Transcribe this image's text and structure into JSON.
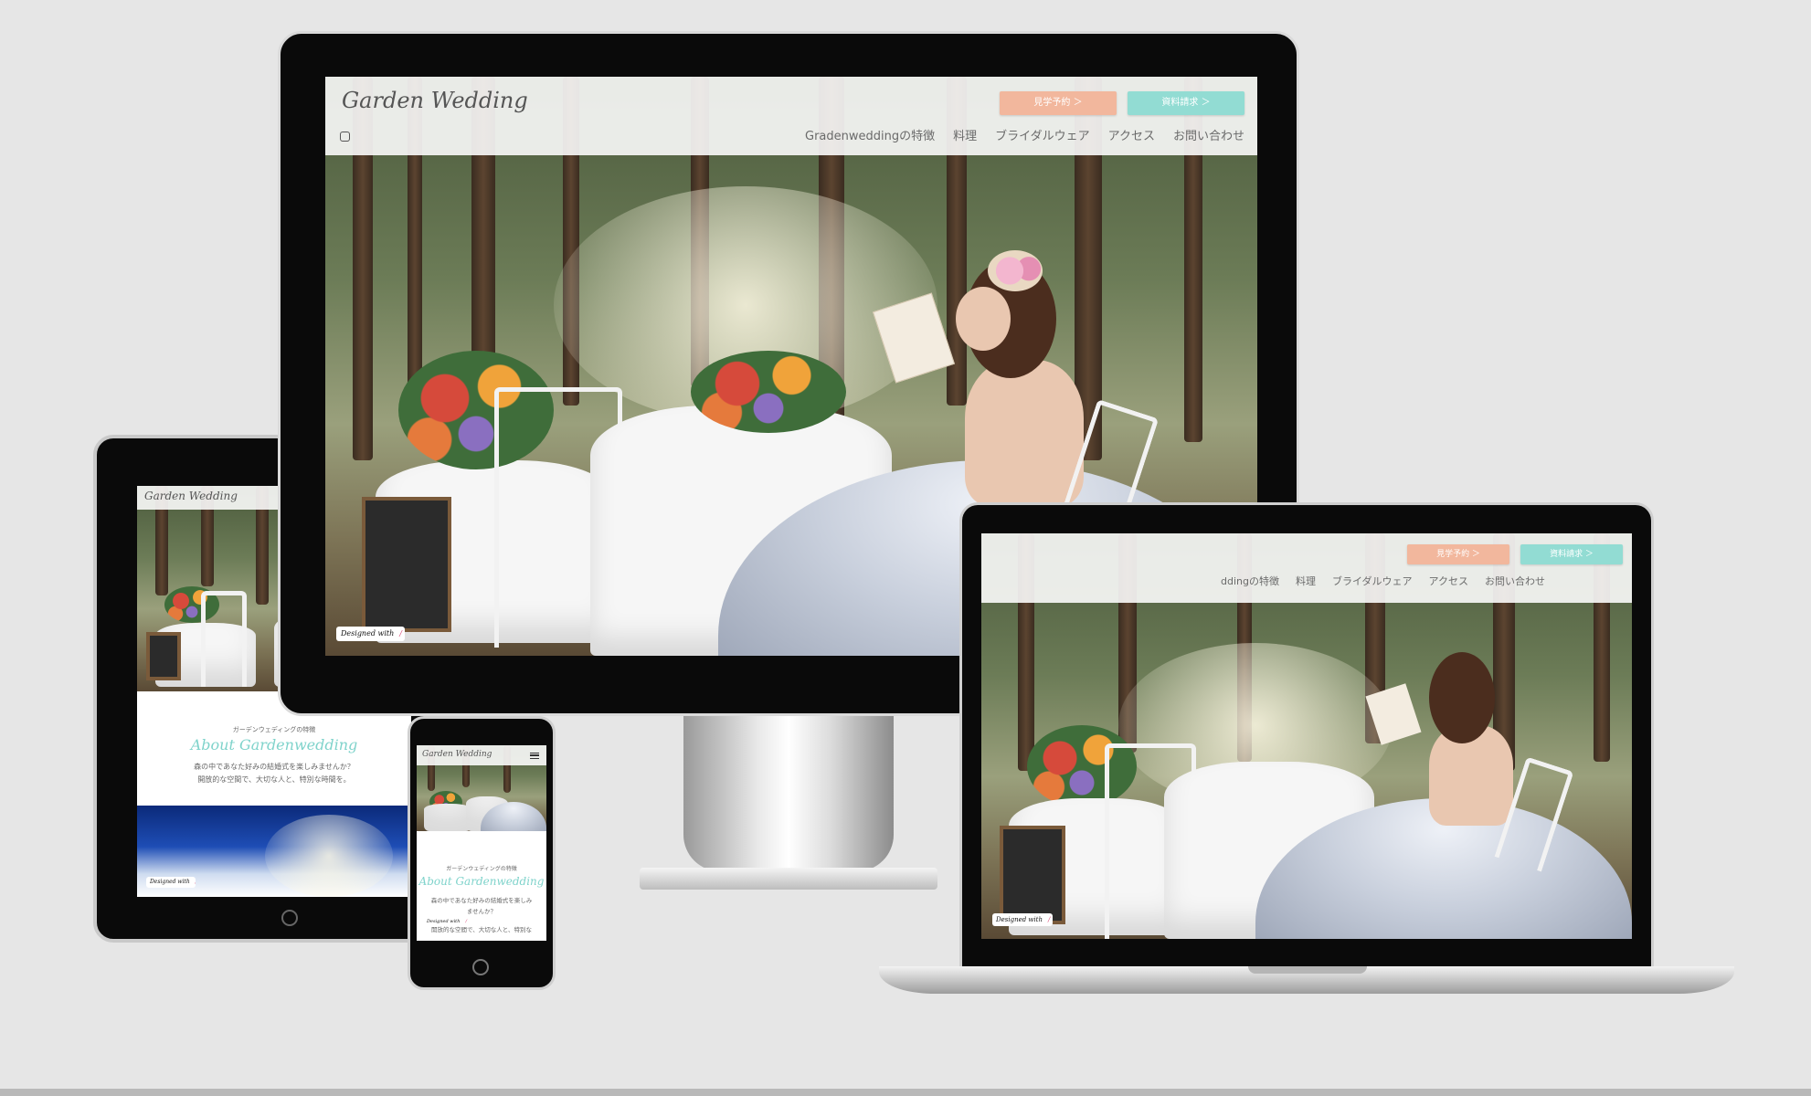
{
  "site": {
    "logo": "Garden Wedding",
    "buttons": {
      "visit": "見学予約 ＞",
      "request": "資料請求 ＞"
    },
    "nav": [
      "Gradenweddingの特徴",
      "料理",
      "ブライダルウェア",
      "アクセス",
      "お問い合わせ"
    ],
    "laptop_nav": [
      "ddingの特徴",
      "料理",
      "ブライダルウェア",
      "アクセス",
      "お問い合わせ"
    ],
    "designed_with": "Designed with",
    "instagram_icon": "instagram-icon"
  },
  "section": {
    "caption": "ガーデンウェディングの特徴",
    "heading": "About Gardenwedding",
    "text_line1": "森の中であなた好みの結婚式を楽しみませんか？",
    "text_line2": "開放的な空間で、大切な人と、特別な時間を。"
  },
  "phone": {
    "caption": "ガーデンウェディングの特徴",
    "heading": "About Gardenwedding",
    "text_line1": "森の中であなた好みの結婚式を楽しみ",
    "text_line2": "ませんか？",
    "text_line3": "開放的な空間で、大切な人と、特別な",
    "menu_icon": "hamburger-menu-icon"
  },
  "colors": {
    "pink": "#f2b79d",
    "mint": "#92dcd3",
    "heading_teal": "#7fd3cb"
  }
}
